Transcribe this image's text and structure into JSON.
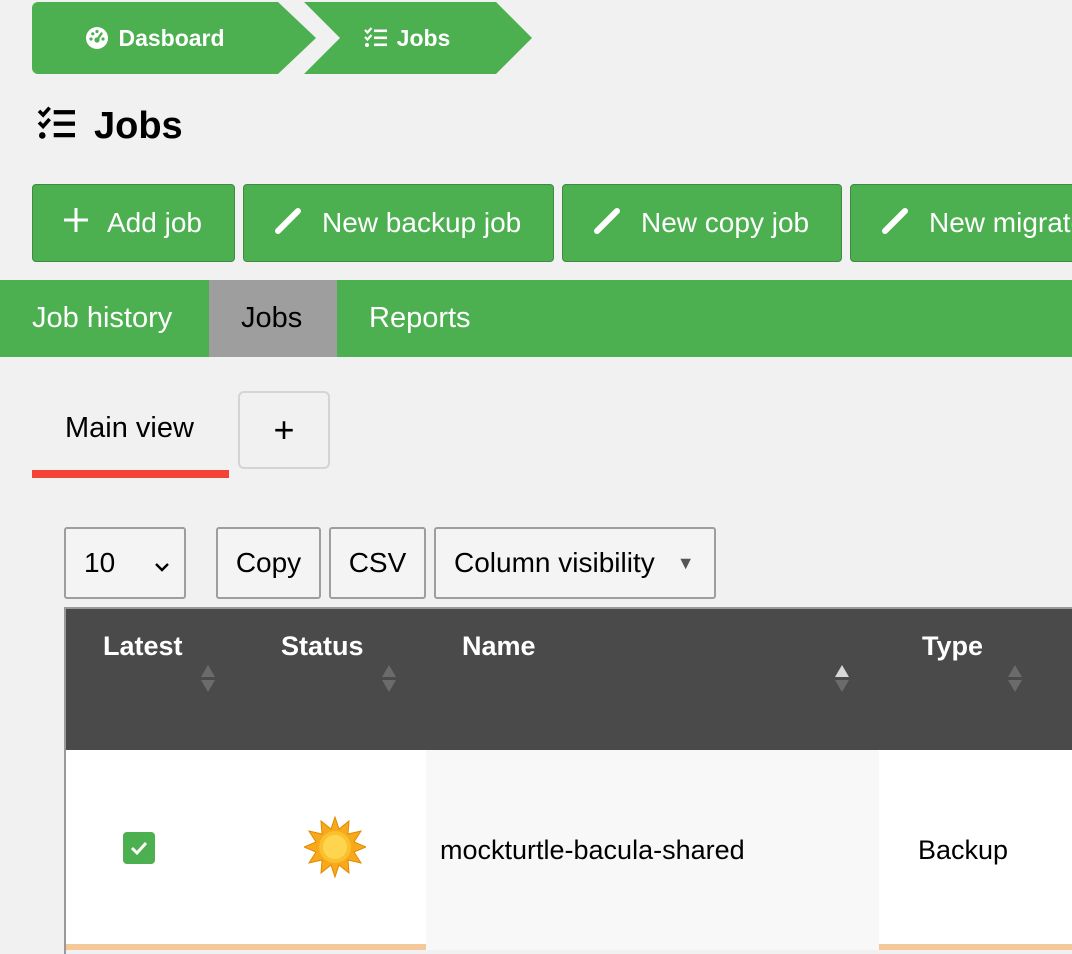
{
  "breadcrumb": {
    "dashboard_label": "Dasboard",
    "jobs_label": "Jobs"
  },
  "page": {
    "title": "Jobs"
  },
  "actions": {
    "add_job": "Add job",
    "new_backup_job": "New backup job",
    "new_copy_job": "New copy job",
    "new_migrate_job": "New migrate job"
  },
  "nav": {
    "items": [
      {
        "label": "Job history"
      },
      {
        "label": "Jobs"
      },
      {
        "label": "Reports"
      }
    ],
    "active": "Jobs"
  },
  "views": {
    "main_view": "Main view",
    "add_label": "+"
  },
  "controls": {
    "page_length": "10",
    "copy": "Copy",
    "csv": "CSV",
    "column_visibility": "Column visibility"
  },
  "table": {
    "columns": [
      "Latest",
      "Status",
      "Name",
      "Type"
    ],
    "rows": [
      {
        "latest": true,
        "status_icon": "sun-icon",
        "name": "mockturtle-bacula-shared",
        "type": "Backup"
      }
    ]
  },
  "colors": {
    "accent_green": "#4caf50",
    "tab_active_underline": "#f44336",
    "nav_active": "#9e9e9e",
    "table_header": "#4a4a4a"
  }
}
